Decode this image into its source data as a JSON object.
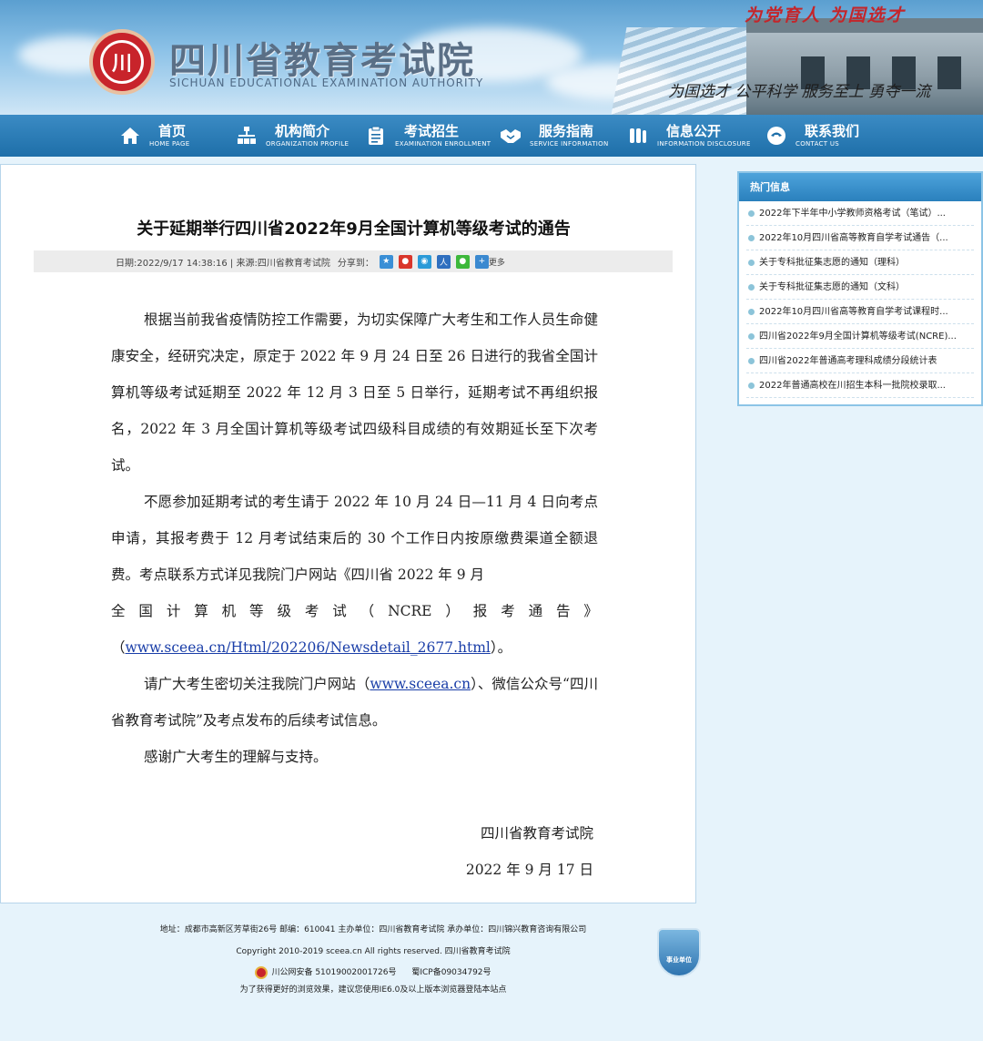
{
  "header": {
    "site_title": "四川省教育考试院",
    "site_subtitle": "SICHUAN EDUCATIONAL EXAMINATION AUTHORITY",
    "seal_text": "川",
    "slogan_top": "为党育人  为国选才",
    "slogan_bottom": "为国选才  公平科学  服务至上  勇夺一流"
  },
  "nav": [
    {
      "cn": "首页",
      "en": "HOME PAGE",
      "icon": "home-icon"
    },
    {
      "cn": "机构简介",
      "en": "ORGANIZATION PROFILE",
      "icon": "org-chart-icon"
    },
    {
      "cn": "考试招生",
      "en": "EXAMINATION ENROLLMENT",
      "icon": "clipboard-icon"
    },
    {
      "cn": "服务指南",
      "en": "SERVICE INFORMATION",
      "icon": "handshake-icon"
    },
    {
      "cn": "信息公开",
      "en": "INFORMATION DISCLOSURE",
      "icon": "people-icon"
    },
    {
      "cn": "联系我们",
      "en": "CONTACT US",
      "icon": "phone-icon"
    }
  ],
  "article": {
    "title": "关于延期举行四川省2022年9月全国计算机等级考试的通告",
    "meta": "日期:2022/9/17 14:38:16 | 来源:四川省教育考试院",
    "share_label": "分享到：",
    "more_label": "更多",
    "p1": "根据当前我省疫情防控工作需要，为切实保障广大考生和工作人员生命健康安全，经研究决定，原定于 2022 年 9 月 24 日至 26 日进行的我省全国计算机等级考试延期至 2022 年 12 月 3 日至 5 日举行，延期考试不再组织报名，2022 年 3 月全国计算机等级考试四级科目成绩的有效期延长至下次考试。",
    "p2a": "不愿参加延期考试的考生请于 2022 年 10 月 24 日—11 月 4 日向考点申请，其报考费于 12 月考试结束后的 30 个工作日内按原缴费渠道全额退费。考点联系方式详见我院门户网站《四川省 2022 年 9 月",
    "p2_spread": [
      "全",
      "国",
      "计",
      "算",
      "机",
      "等",
      "级",
      "考",
      "试",
      "（",
      "NCRE",
      "）",
      "报",
      "考",
      "通",
      "告",
      "》"
    ],
    "p2_link_open": "（",
    "p2_link": "www.sceea.cn/Html/202206/Newsdetail_2677.html",
    "p2_link_close": "）。",
    "p3a": "请广大考生密切关注我院门户网站（",
    "p3_link": "www.sceea.cn",
    "p3b": "）、微信公众号“四川省教育考试院”及考点发布的后续考试信息。",
    "p4": "感谢广大考生的理解与支持。",
    "signature_org": "四川省教育考试院",
    "signature_date": "2022 年 9 月 17 日"
  },
  "sidebar": {
    "header": "热门信息",
    "items": [
      "2022年下半年中小学教师资格考试（笔试）...",
      "2022年10月四川省高等教育自学考试通告（...",
      "关于专科批征集志愿的通知（理科）",
      "关于专科批征集志愿的通知（文科）",
      "2022年10月四川省高等教育自学考试课程时...",
      "四川省2022年9月全国计算机等级考试(NCRE)...",
      "四川省2022年普通高考理科成绩分段统计表",
      "2022年普通高校在川招生本科一批院校录取..."
    ]
  },
  "footer": {
    "address": "地址：成都市高新区芳草街26号 邮编：610041 主办单位：四川省教育考试院 承办单位：四川锦兴教育咨询有限公司",
    "copyright": "Copyright 2010-2019 sceea.cn All rights reserved. 四川省教育考试院",
    "police": "川公网安备 51019002001726号",
    "icp": "蜀ICP备09034792号",
    "browser_note": "为了获得更好的浏览效果，建议您使用IE6.0及以上版本浏览器登陆本站点",
    "badge": "事业单位"
  },
  "colors": {
    "nav_bg": "#1e6fa9",
    "slogan_red": "#c4252a",
    "link": "#1a3ea8",
    "sidebar_header": "#2a80bd"
  }
}
